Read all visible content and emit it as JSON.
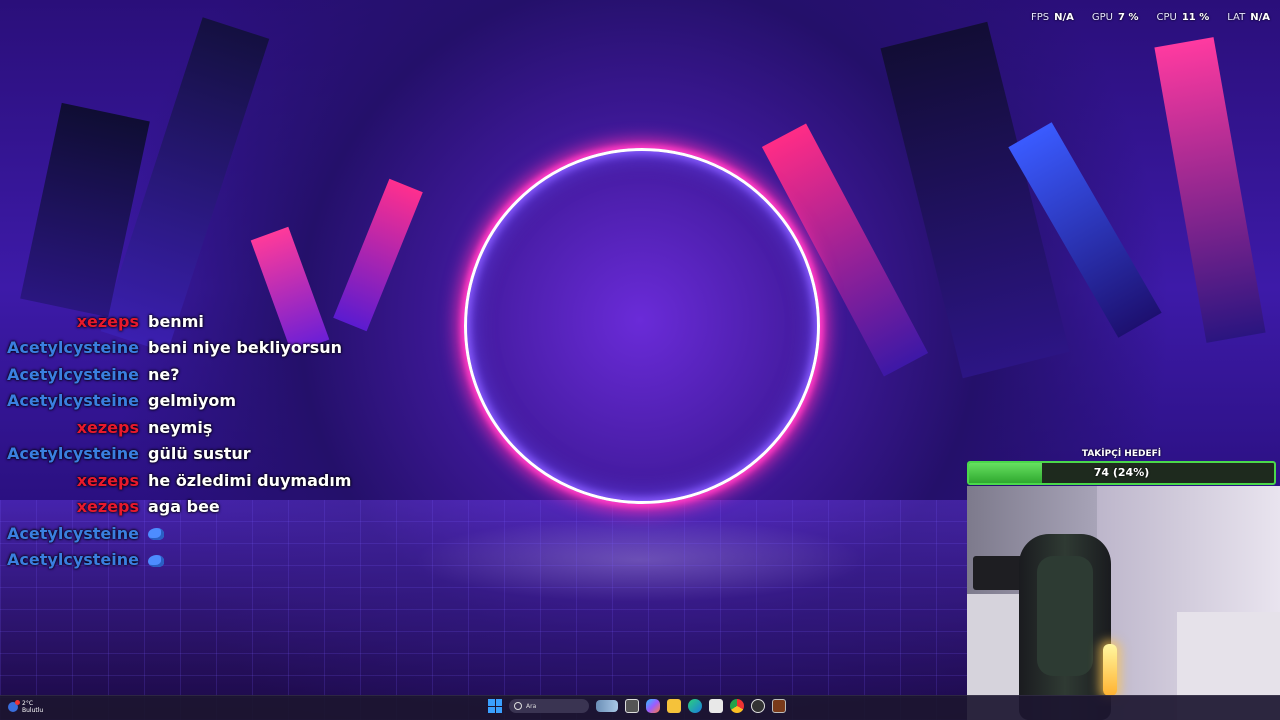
{
  "stats": [
    {
      "label": "FPS",
      "value": "N/A"
    },
    {
      "label": "GPU",
      "value": "7 %"
    },
    {
      "label": "CPU",
      "value": "11 %"
    },
    {
      "label": "LAT",
      "value": "N/A"
    }
  ],
  "chat": {
    "messages": [
      {
        "user": "xezeps",
        "text": "benmi",
        "color": "red"
      },
      {
        "user": "Acetylcysteine",
        "text": "beni niye bekliyorsun",
        "color": "blue"
      },
      {
        "user": "Acetylcysteine",
        "text": "ne?",
        "color": "blue"
      },
      {
        "user": "Acetylcysteine",
        "text": "gelmiyom",
        "color": "blue"
      },
      {
        "user": "xezeps",
        "text": "neymiş",
        "color": "red"
      },
      {
        "user": "Acetylcysteine",
        "text": "gülü sustur",
        "color": "blue"
      },
      {
        "user": "xezeps",
        "text": "he özledimi duymadım",
        "color": "red"
      },
      {
        "user": "xezeps",
        "text": "aga bee",
        "color": "red"
      },
      {
        "user": "Acetylcysteine",
        "text": "",
        "emote": "emote-icon",
        "color": "blue"
      },
      {
        "user": "Acetylcysteine",
        "text": "",
        "emote": "emote-icon",
        "color": "blue"
      }
    ],
    "colors": {
      "red": "#e8192c",
      "blue": "#3a7fe0"
    }
  },
  "goal": {
    "title": "TAKİPÇİ HEDEFİ",
    "text": "74 (24%)",
    "progress": 0.24,
    "color": "#4bd84b"
  },
  "taskbar": {
    "weather_temp": "2°C",
    "weather_desc": "Bulutlu",
    "search_placeholder": "Ara",
    "apps": [
      "task-view-icon",
      "copilot-icon",
      "file-explorer-icon",
      "edge-icon",
      "store-icon",
      "chrome-icon",
      "obs-icon",
      "app-icon"
    ]
  }
}
